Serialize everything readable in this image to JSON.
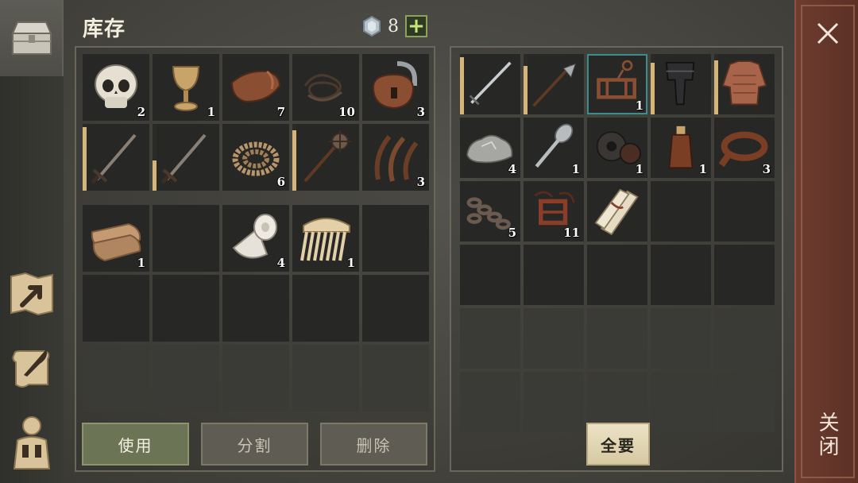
{
  "header": {
    "title": "库存",
    "gem_count": "8",
    "plus_label": "+"
  },
  "sidebar": {
    "items": [
      {
        "icon": "chest-icon",
        "active": true
      },
      {
        "icon": "map-arrow-icon",
        "active": false
      },
      {
        "icon": "scroll-quill-icon",
        "active": false
      },
      {
        "icon": "character-backpack-icon",
        "active": false
      }
    ]
  },
  "inventory": {
    "top_grid": [
      {
        "icon": "skull-icon",
        "count": "2"
      },
      {
        "icon": "goblet-icon",
        "count": "1"
      },
      {
        "icon": "leather-hide-icon",
        "count": "7"
      },
      {
        "icon": "wire-coil-icon",
        "count": "10"
      },
      {
        "icon": "padlock-icon",
        "count": "3"
      },
      {
        "icon": "sword-icon",
        "count": "",
        "durability": 0.95
      },
      {
        "icon": "sword-icon",
        "count": "",
        "durability": 0.45
      },
      {
        "icon": "rope-icon",
        "count": "6"
      },
      {
        "icon": "mace-icon",
        "count": "",
        "durability": 0.9
      },
      {
        "icon": "fiber-strands-icon",
        "count": "3"
      }
    ],
    "bottom_grid": [
      {
        "icon": "folded-cloth-icon",
        "count": "1"
      },
      {
        "icon": "",
        "count": ""
      },
      {
        "icon": "bandage-roll-icon",
        "count": "4"
      },
      {
        "icon": "comb-icon",
        "count": "1"
      }
    ],
    "buttons": {
      "use": "使用",
      "split": "分割",
      "delete": "删除"
    }
  },
  "loot": {
    "grid": [
      {
        "icon": "longsword-icon",
        "count": "",
        "durability": 0.95
      },
      {
        "icon": "halberd-icon",
        "count": "",
        "durability": 0.8
      },
      {
        "icon": "rack-trap-icon",
        "count": "1",
        "highlight": true
      },
      {
        "icon": "leg-armor-icon",
        "count": "",
        "durability": 0.85
      },
      {
        "icon": "chainmail-shirt-icon",
        "count": "",
        "durability": 0.9
      },
      {
        "icon": "stone-ore-icon",
        "count": "4"
      },
      {
        "icon": "spoon-icon",
        "count": "1"
      },
      {
        "icon": "gears-icon",
        "count": "1"
      },
      {
        "icon": "bottle-icon",
        "count": "1"
      },
      {
        "icon": "leather-strap-icon",
        "count": "3"
      },
      {
        "icon": "chain-icon",
        "count": "5"
      },
      {
        "icon": "scrap-parts-icon",
        "count": "11"
      },
      {
        "icon": "scroll-bundle-icon",
        "count": ""
      }
    ],
    "take_all": "全要"
  },
  "close": {
    "label": "关闭"
  }
}
